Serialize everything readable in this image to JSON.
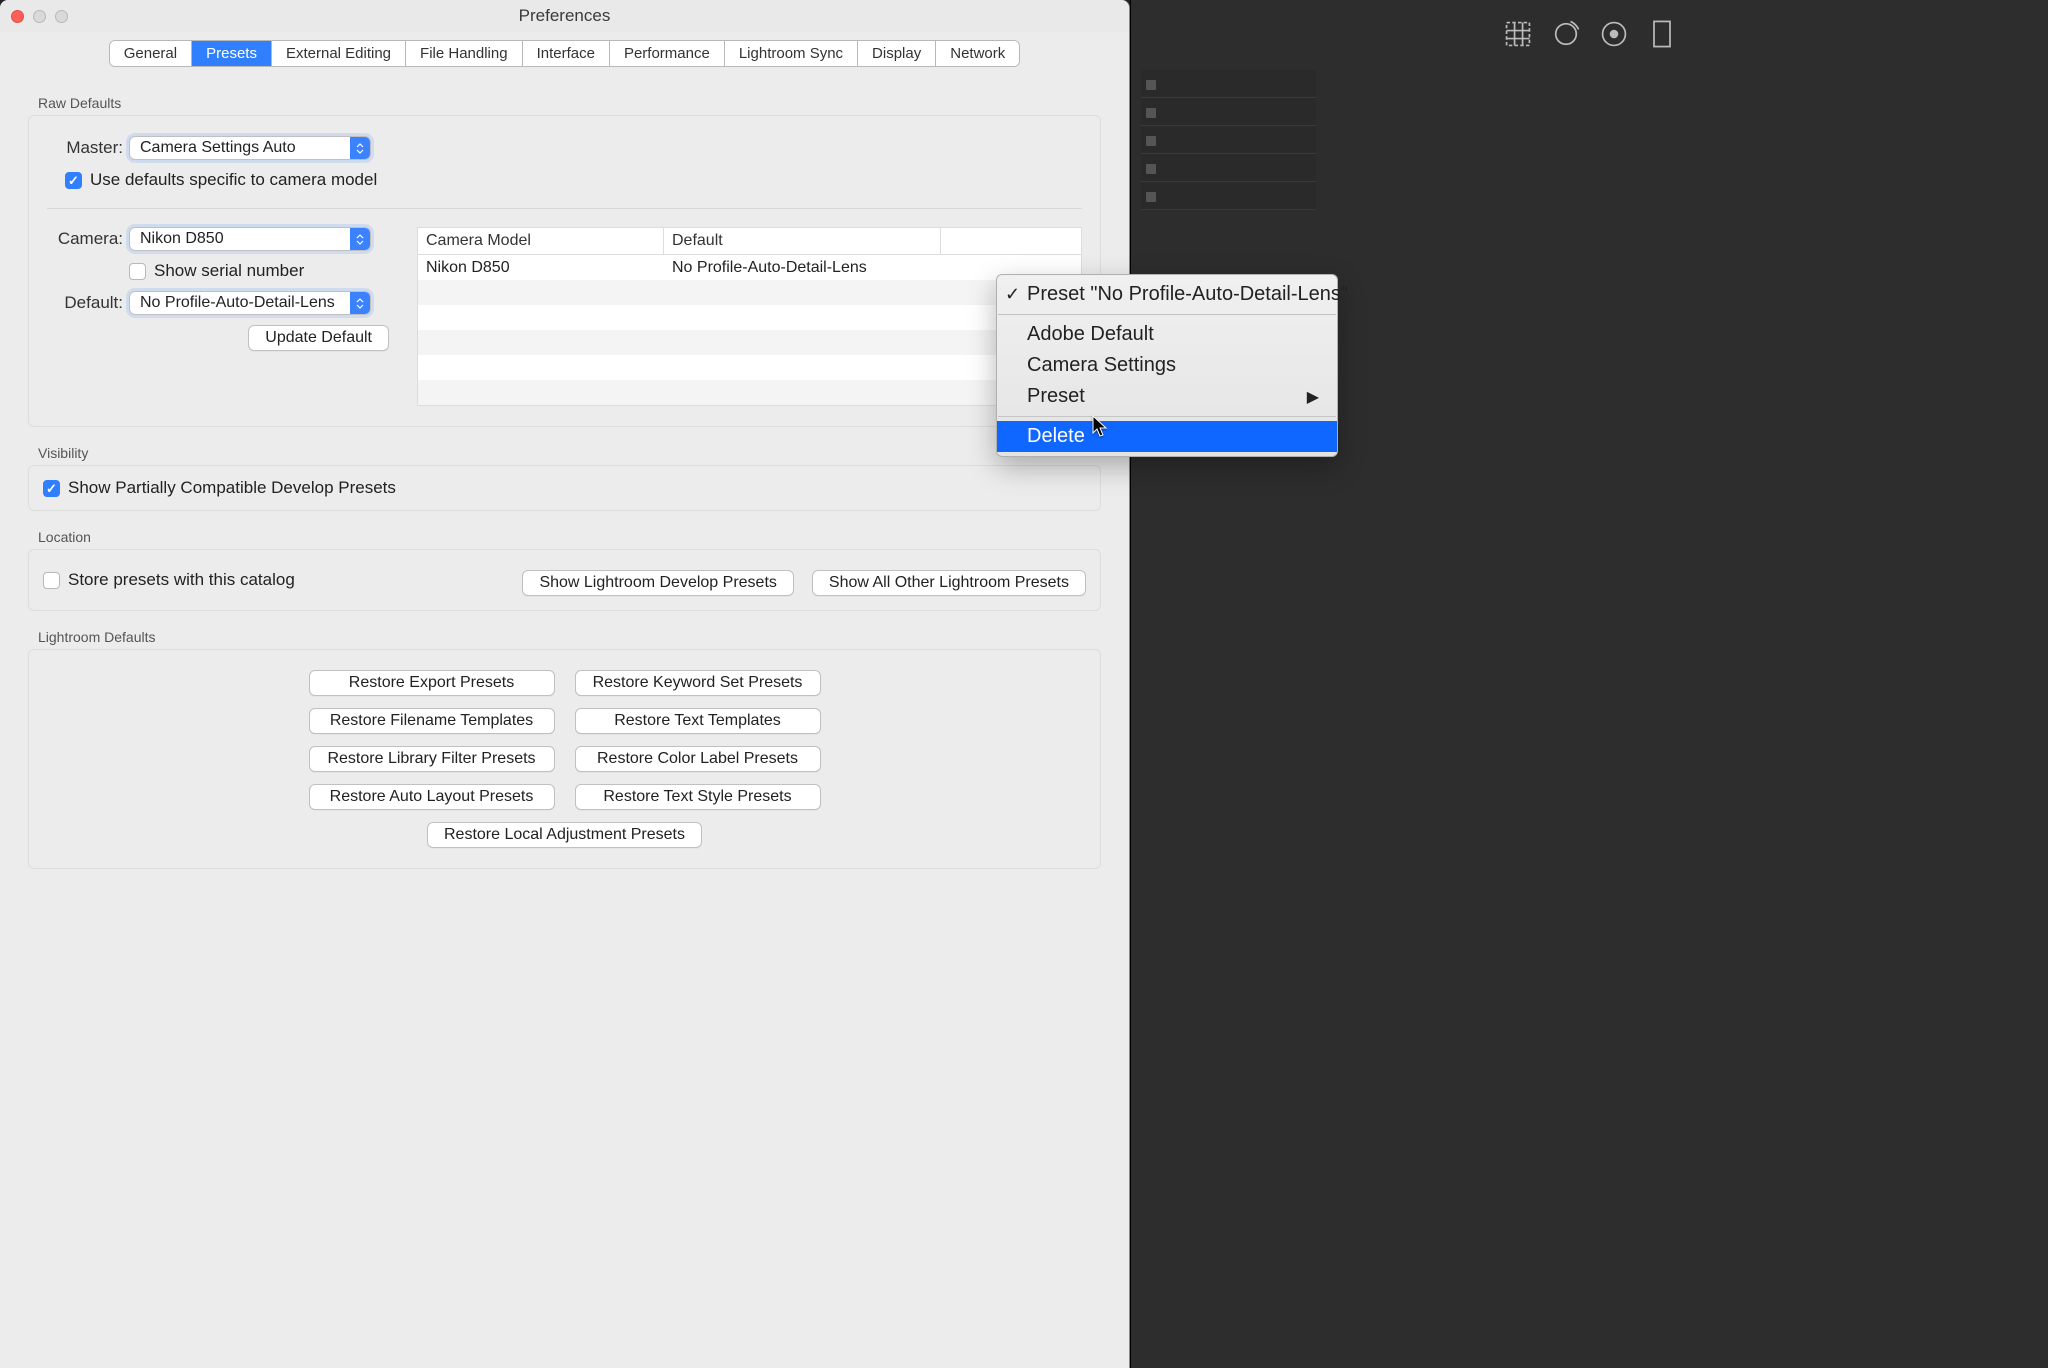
{
  "window": {
    "title": "Preferences"
  },
  "tabs": [
    "General",
    "Presets",
    "External Editing",
    "File Handling",
    "Interface",
    "Performance",
    "Lightroom Sync",
    "Display",
    "Network"
  ],
  "active_tab": "Presets",
  "raw_defaults": {
    "label": "Raw Defaults",
    "master_label": "Master:",
    "master_value": "Camera Settings Auto",
    "use_defaults_label": "Use defaults specific to camera model",
    "camera_label": "Camera:",
    "camera_value": "Nikon D850",
    "show_serial_label": "Show serial number",
    "default_label": "Default:",
    "default_value": "No Profile-Auto-Detail-Lens",
    "update_button": "Update Default",
    "table": {
      "col1": "Camera Model",
      "col2": "Default",
      "rows": [
        {
          "model": "Nikon D850",
          "default": "No Profile-Auto-Detail-Lens"
        }
      ]
    }
  },
  "visibility": {
    "label": "Visibility",
    "show_partial_label": "Show Partially Compatible Develop Presets"
  },
  "location": {
    "label": "Location",
    "store_label": "Store presets with this catalog",
    "btn_show_dev": "Show Lightroom Develop Presets",
    "btn_show_all": "Show All Other Lightroom Presets"
  },
  "lr_defaults": {
    "label": "Lightroom Defaults",
    "buttons": [
      "Restore Export Presets",
      "Restore Keyword Set Presets",
      "Restore Filename Templates",
      "Restore Text Templates",
      "Restore Library Filter Presets",
      "Restore Color Label Presets",
      "Restore Auto Layout Presets",
      "Restore Text Style Presets",
      "Restore Local Adjustment Presets"
    ]
  },
  "context_menu": {
    "current": "Preset \"No Profile-Auto-Detail-Lens\"",
    "adobe_default": "Adobe Default",
    "camera_settings": "Camera Settings",
    "preset": "Preset",
    "delete": "Delete"
  }
}
